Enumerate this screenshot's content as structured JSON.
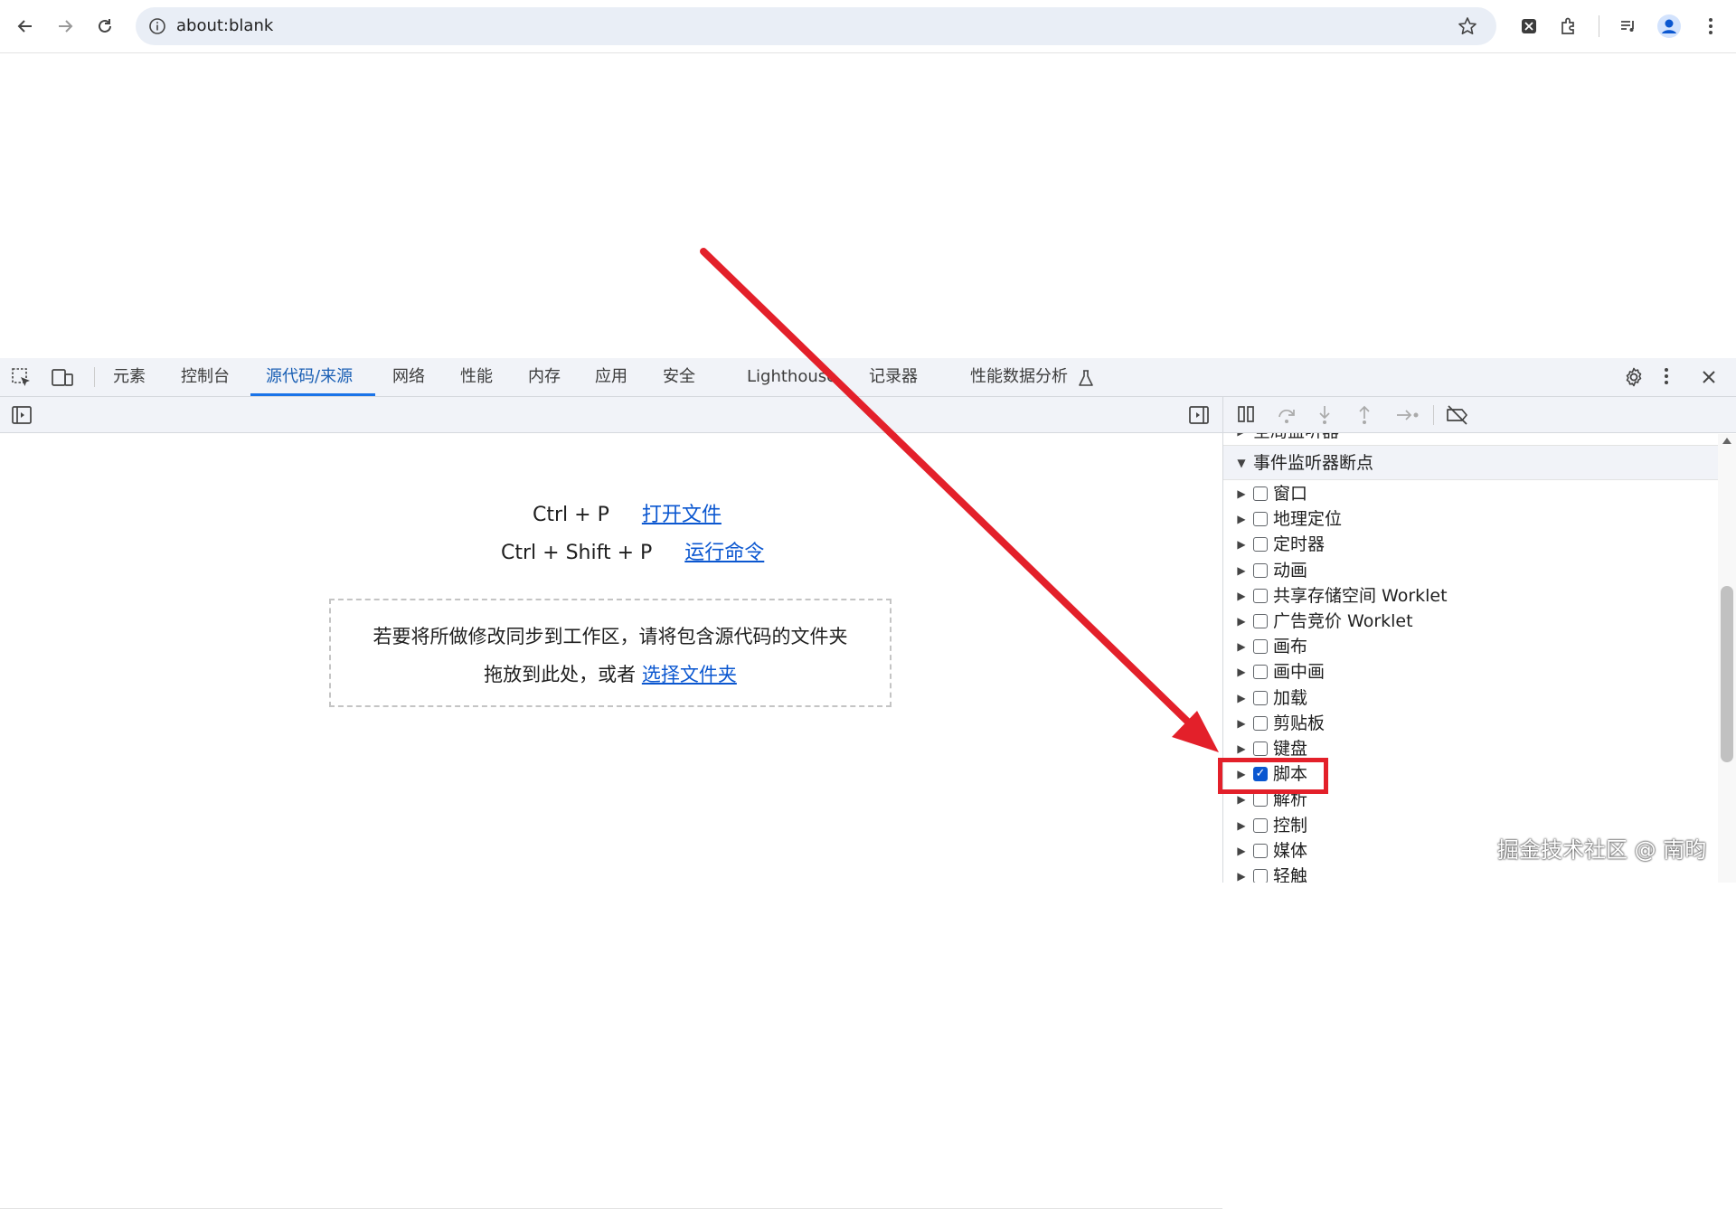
{
  "browser": {
    "url": "about:blank",
    "icons": [
      "back-icon",
      "forward-icon",
      "reload-icon",
      "site-info-icon",
      "bookmark-star-icon",
      "extension-x-icon",
      "extensions-puzzle-icon",
      "media-queue-icon",
      "profile-avatar-icon",
      "menu-kebab-icon"
    ]
  },
  "devtools": {
    "tabs": [
      "元素",
      "控制台",
      "源代码/来源",
      "网络",
      "性能",
      "内存",
      "应用",
      "安全",
      "Lighthouse",
      "记录器",
      "性能数据分析"
    ],
    "active_tab": "源代码/来源",
    "editor": {
      "shortcut1_keys": "Ctrl + P",
      "shortcut1_action": "打开文件",
      "shortcut2_keys": "Ctrl + Shift + P",
      "shortcut2_action": "运行命令",
      "drop_line1": "若要将所做修改同步到工作区，请将包含源代码的文件夹",
      "drop_line2_prefix": "拖放到此处，或者",
      "drop_link": "选择文件夹"
    },
    "sidebar": {
      "collapsed_section_partial": "全局监听器",
      "section_title": "事件监听器断点",
      "items": [
        {
          "label": "窗口",
          "checked": false
        },
        {
          "label": "地理定位",
          "checked": false
        },
        {
          "label": "定时器",
          "checked": false
        },
        {
          "label": "动画",
          "checked": false
        },
        {
          "label": "共享存储空间 Worklet",
          "checked": false
        },
        {
          "label": "广告竞价 Worklet",
          "checked": false
        },
        {
          "label": "画布",
          "checked": false
        },
        {
          "label": "画中画",
          "checked": false
        },
        {
          "label": "加载",
          "checked": false
        },
        {
          "label": "剪贴板",
          "checked": false
        },
        {
          "label": "键盘",
          "checked": false
        },
        {
          "label": "脚本",
          "checked": true
        },
        {
          "label": "解析",
          "checked": false
        },
        {
          "label": "控制",
          "checked": false
        },
        {
          "label": "媒体",
          "checked": false
        },
        {
          "label": "轻触",
          "checked": false
        }
      ]
    }
  },
  "annotation": {
    "arrow_color": "#e3202a",
    "highlight_color": "#e3202a"
  },
  "watermark": "掘金技术社区 @ 南昀"
}
